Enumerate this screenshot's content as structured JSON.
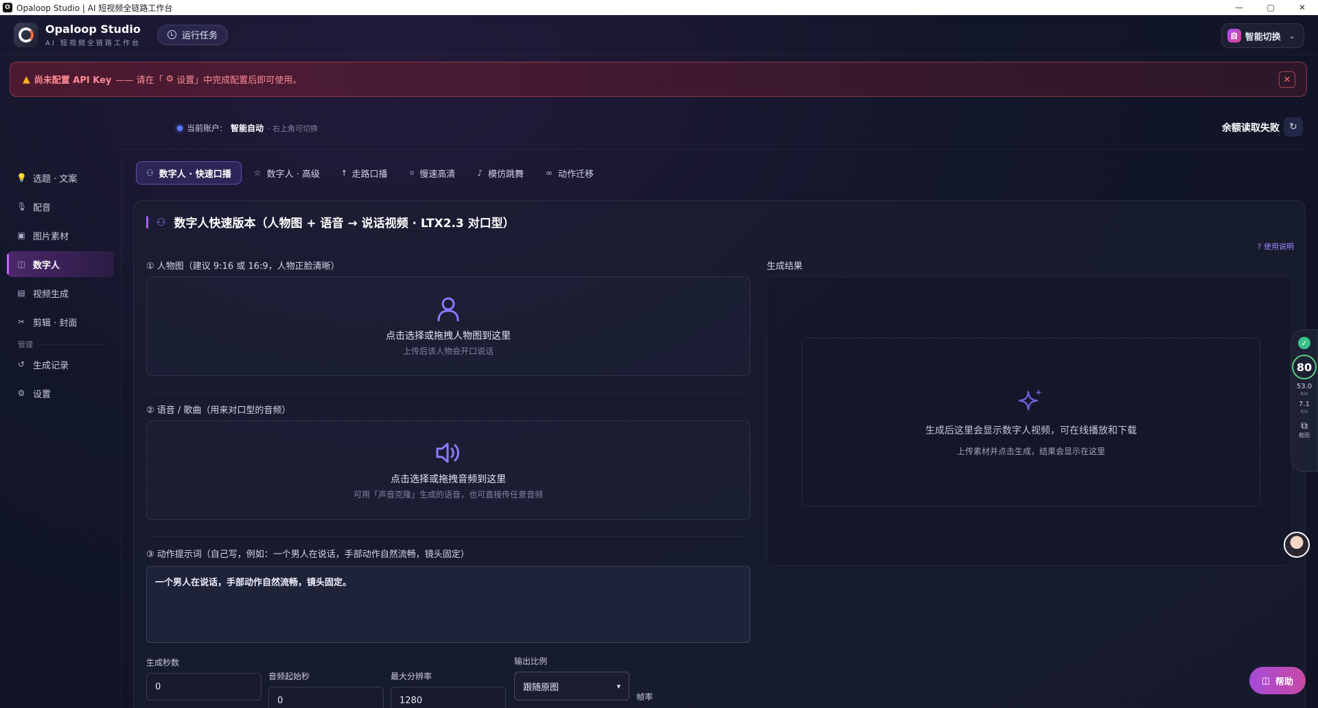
{
  "window": {
    "title": "Opaloop Studio | AI 短视频全链路工作台",
    "controls": [
      "—",
      "▢",
      "✕"
    ]
  },
  "header": {
    "brand_name": "Opaloop Studio",
    "brand_sub": "AI 短视频全链路工作台",
    "run_tasks": "运行任务",
    "switch_badge": "自",
    "switch_label": "智能切换"
  },
  "alert": {
    "text_strong": "尚未配置 API Key",
    "text_rest": "—— 请在「",
    "settings_word": "设置",
    "text_end": "」中完成配置后即可使用。"
  },
  "account": {
    "label": "当前账户:",
    "value": "智能自动",
    "hint": "· 右上角可切换",
    "balance": "余额读取失败"
  },
  "sidebar": {
    "items": [
      {
        "label": "选题 · 文案",
        "icon": "lightbulb-icon"
      },
      {
        "label": "配音",
        "icon": "mic-icon"
      },
      {
        "label": "图片素材",
        "icon": "image-icon"
      },
      {
        "label": "数字人",
        "icon": "robot-icon"
      },
      {
        "label": "视频生成",
        "icon": "clapper-icon"
      },
      {
        "label": "剪辑 · 封面",
        "icon": "scissors-icon"
      }
    ],
    "group_label": "管理",
    "manage_items": [
      {
        "label": "生成记录",
        "icon": "history-icon"
      },
      {
        "label": "设置",
        "icon": "gear-icon"
      }
    ]
  },
  "tabs": [
    {
      "label": "数字人 · 快速口播",
      "icon": "person-icon"
    },
    {
      "label": "数字人 · 高级",
      "icon": "star-icon"
    },
    {
      "label": "走路口播",
      "icon": "walk-icon"
    },
    {
      "label": "慢速高清",
      "icon": "scan-icon"
    },
    {
      "label": "模仿跳舞",
      "icon": "music-icon"
    },
    {
      "label": "动作迁移",
      "icon": "footprints-icon"
    }
  ],
  "panel": {
    "title": "数字人快速版本（人物图 + 语音 → 说话视频 · LTX2.3 对口型）",
    "help_link": "? 使用说明",
    "section1_label": "① 人物图（建议 9:16 或 16:9，人物正脸清晰）",
    "dz1_main": "点击选择或拖拽人物图到这里",
    "dz1_sub": "上传后该人物会开口说话",
    "section2_label": "② 语音 / 歌曲（用来对口型的音频）",
    "dz2_main": "点击选择或拖拽音频到这里",
    "dz2_sub": "可用「声音克隆」生成的语音，也可直接传任意音频",
    "section3_label": "③ 动作提示词（自己写，例如：一个男人在说话，手部动作自然流畅，镜头固定）",
    "prompt_value": "一个男人在说话，手部动作自然流畅，镜头固定。",
    "fields": {
      "gen_seconds_label": "生成秒数",
      "gen_seconds_value": "0",
      "audio_start_label": "音频起始秒",
      "audio_start_value": "0",
      "max_res_label": "最大分辨率",
      "max_res_value": "1280",
      "ratio_label": "输出比例",
      "ratio_value": "跟随原图",
      "fps_label": "帧率"
    },
    "result_label": "生成结果",
    "result_main": "生成后这里会显示数字人视频，可在线播放和下载",
    "result_sub": "上传素材并点击生成，结果会显示在这里"
  },
  "float_bar": {
    "score": "80",
    "up_value": "53.0",
    "up_unit": "K/s",
    "down_value": "7.1",
    "down_unit": "K/s",
    "screenshot_label": "截图"
  },
  "help_button": "帮助",
  "colors": {
    "accent": "#b05cff",
    "alert_text": "#ff8a95",
    "success": "#3bc28a"
  }
}
